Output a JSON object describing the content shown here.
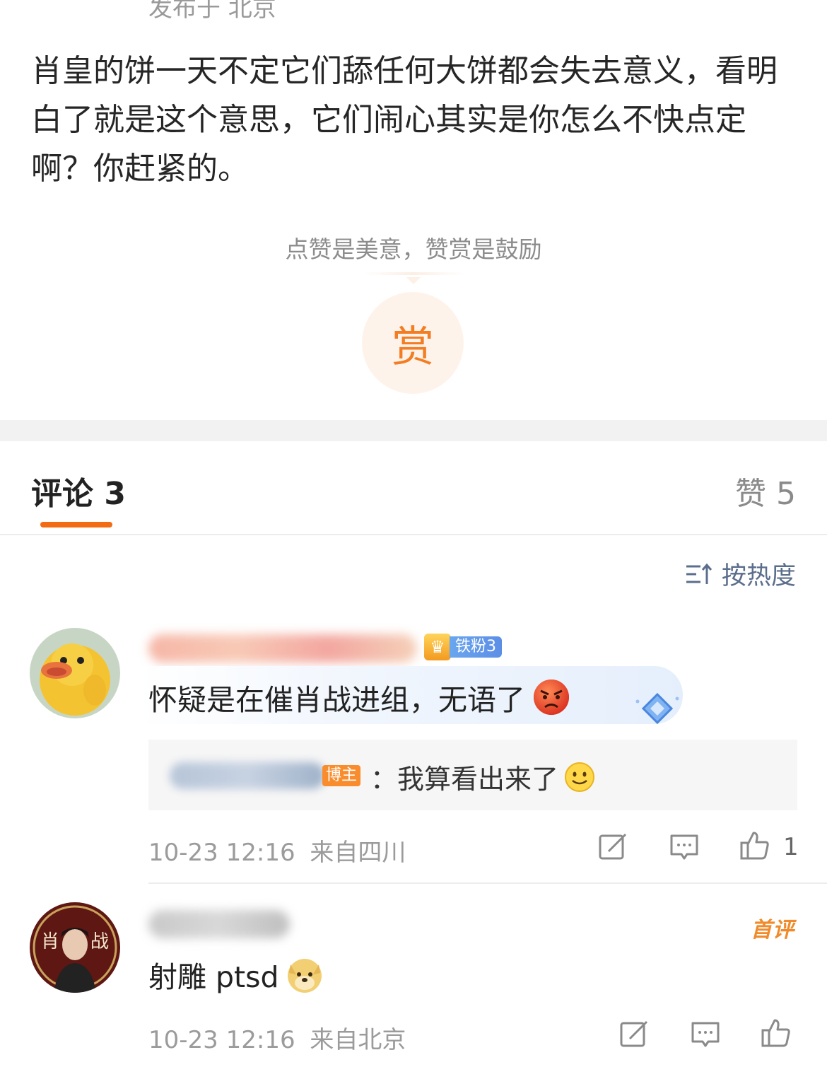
{
  "post": {
    "location": "发布于 北京",
    "body": "肖皇的饼一天不定它们舔任何大饼都会失去意义，看明白了就是这个意思，它们闹心其实是你怎么不快点定啊？你赶紧的。"
  },
  "reward": {
    "hint": "点赞是美意，赞赏是鼓励",
    "button_label": "赏"
  },
  "tabs": {
    "comments_label": "评论 3",
    "likes_label": "赞 5"
  },
  "sort": {
    "label": "按热度"
  },
  "comments": [
    {
      "badge": "铁粉3",
      "text": "怀疑是在催肖战进组，无语了",
      "reply": {
        "host_badge": "博主",
        "text": "：我算看出来了"
      },
      "time": "10-23 12:16",
      "location": "来自四川",
      "likes": "1"
    },
    {
      "first_comment_badge": "首评",
      "text": "射雕 ptsd",
      "time": "10-23 12:16",
      "location": "来自北京"
    }
  ],
  "icons": {
    "repost": "repost-icon",
    "comment": "comment-icon",
    "like": "thumbs-up-icon"
  },
  "colors": {
    "accent": "#f36b12",
    "reward": "#f27d22",
    "sort": "#5b6e8c"
  }
}
